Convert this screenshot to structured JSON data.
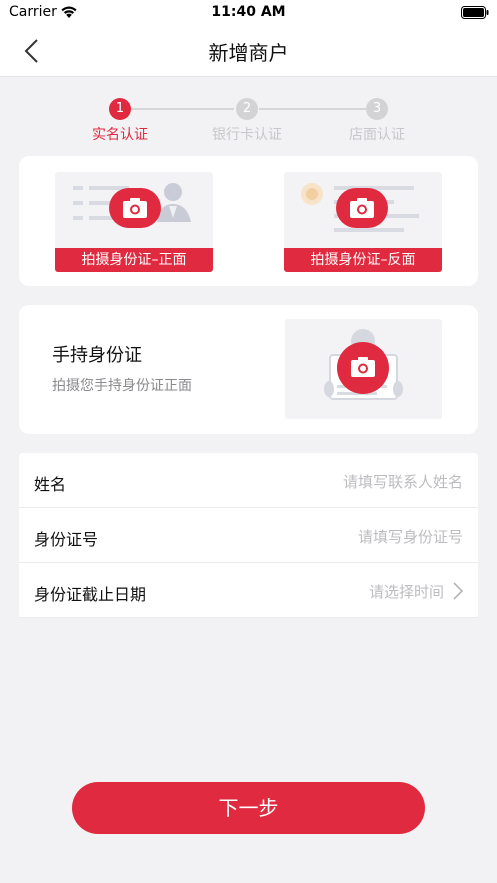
{
  "status": {
    "carrier": "Carrier",
    "time": "11:40 AM"
  },
  "nav": {
    "title": "新增商户"
  },
  "steps": [
    {
      "num": "1",
      "label": "实名认证"
    },
    {
      "num": "2",
      "label": "银行卡认证"
    },
    {
      "num": "3",
      "label": "店面认证"
    }
  ],
  "id_upload": {
    "front_label": "拍摄身份证–正面",
    "back_label": "拍摄身份证–反面"
  },
  "hand_held": {
    "title": "手持身份证",
    "subtitle": "拍摄您手持身份证正面"
  },
  "form": {
    "rows": [
      {
        "label": "姓名",
        "placeholder": "请填写联系人姓名"
      },
      {
        "label": "身份证号",
        "placeholder": "请填写身份证号"
      },
      {
        "label": "身份证截止日期",
        "placeholder": "请选择时间"
      }
    ]
  },
  "footer": {
    "next_label": "下一步"
  },
  "colors": {
    "accent": "#e02a3f",
    "background": "#f2f2f4",
    "inactive": "#d3d3d5"
  }
}
